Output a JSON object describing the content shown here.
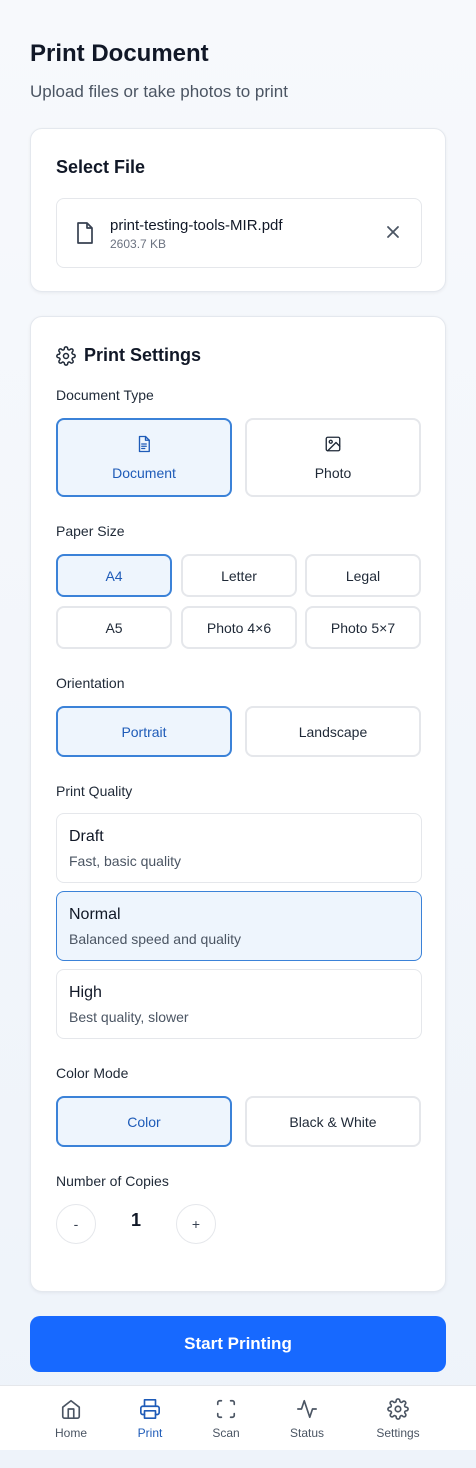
{
  "header": {
    "title": "Print Document",
    "subtitle": "Upload files or take photos to print"
  },
  "file_card": {
    "heading": "Select File",
    "file": {
      "name": "print-testing-tools-MIR.pdf",
      "size": "2603.7 KB",
      "icon": "file-icon"
    },
    "remove_icon": "close-icon"
  },
  "settings": {
    "heading": "Print Settings",
    "heading_icon": "gear-icon",
    "document_type": {
      "label": "Document Type",
      "options": [
        {
          "label": "Document",
          "icon": "document-icon",
          "selected": true
        },
        {
          "label": "Photo",
          "icon": "image-icon",
          "selected": false
        }
      ]
    },
    "paper_size": {
      "label": "Paper Size",
      "options": [
        {
          "label": "A4",
          "selected": true
        },
        {
          "label": "Letter",
          "selected": false
        },
        {
          "label": "Legal",
          "selected": false
        },
        {
          "label": "A5",
          "selected": false
        },
        {
          "label": "Photo 4×6",
          "selected": false
        },
        {
          "label": "Photo 5×7",
          "selected": false
        }
      ]
    },
    "orientation": {
      "label": "Orientation",
      "options": [
        {
          "label": "Portrait",
          "selected": true
        },
        {
          "label": "Landscape",
          "selected": false
        }
      ]
    },
    "print_quality": {
      "label": "Print Quality",
      "options": [
        {
          "name": "Draft",
          "description": "Fast, basic quality",
          "selected": false
        },
        {
          "name": "Normal",
          "description": "Balanced speed and quality",
          "selected": true
        },
        {
          "name": "High",
          "description": "Best quality, slower",
          "selected": false
        }
      ]
    },
    "color_mode": {
      "label": "Color Mode",
      "options": [
        {
          "label": "Color",
          "selected": true
        },
        {
          "label": "Black & White",
          "selected": false
        }
      ]
    },
    "copies": {
      "label": "Number of Copies",
      "decrement_label": "-",
      "value": "1",
      "increment_label": "+"
    }
  },
  "actions": {
    "start_label": "Start Printing"
  },
  "nav": {
    "items": [
      {
        "label": "Home",
        "icon": "home-icon",
        "active": false
      },
      {
        "label": "Print",
        "icon": "printer-icon",
        "active": true
      },
      {
        "label": "Scan",
        "icon": "scan-icon",
        "active": false
      },
      {
        "label": "Status",
        "icon": "activity-icon",
        "active": false
      },
      {
        "label": "Settings",
        "icon": "gear-icon",
        "active": false
      }
    ]
  },
  "colors": {
    "accent": "#1769ff",
    "selected_border": "#3b82d8",
    "selected_bg": "#eef5fd",
    "selected_text": "#1e5bb8"
  }
}
